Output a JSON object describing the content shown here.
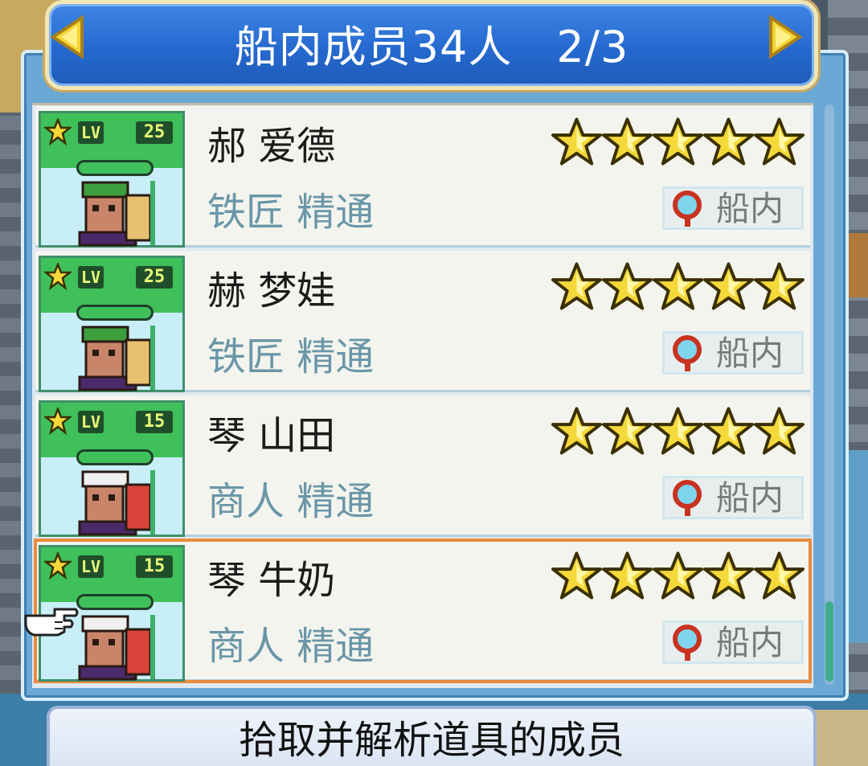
{
  "header": {
    "title": "船内成员34人　2/3",
    "prev_icon": "triangle-left-icon",
    "next_icon": "triangle-right-icon"
  },
  "crew": [
    {
      "name": "郝 爱德",
      "role": "铁匠 精通",
      "level_label": "LV",
      "level": "25",
      "stars": 5,
      "location": "船内",
      "location_icon": "magnifier-icon",
      "selected": false
    },
    {
      "name": "赫 梦娃",
      "role": "铁匠 精通",
      "level_label": "LV",
      "level": "25",
      "stars": 5,
      "location": "船内",
      "location_icon": "magnifier-icon",
      "selected": false
    },
    {
      "name": "琴 山田",
      "role": "商人 精通",
      "level_label": "LV",
      "level": "15",
      "stars": 5,
      "location": "船内",
      "location_icon": "magnifier-icon",
      "selected": false
    },
    {
      "name": "琴 牛奶",
      "role": "商人 精通",
      "level_label": "LV",
      "level": "15",
      "stars": 5,
      "location": "船内",
      "location_icon": "magnifier-icon",
      "selected": true
    }
  ],
  "caption": "拾取并解析道具的成员",
  "colors": {
    "header_blue": "#2a6fd8",
    "gold": "#f5d83a",
    "selected_border": "#ea8a3e",
    "role_text": "#6a97a8"
  }
}
